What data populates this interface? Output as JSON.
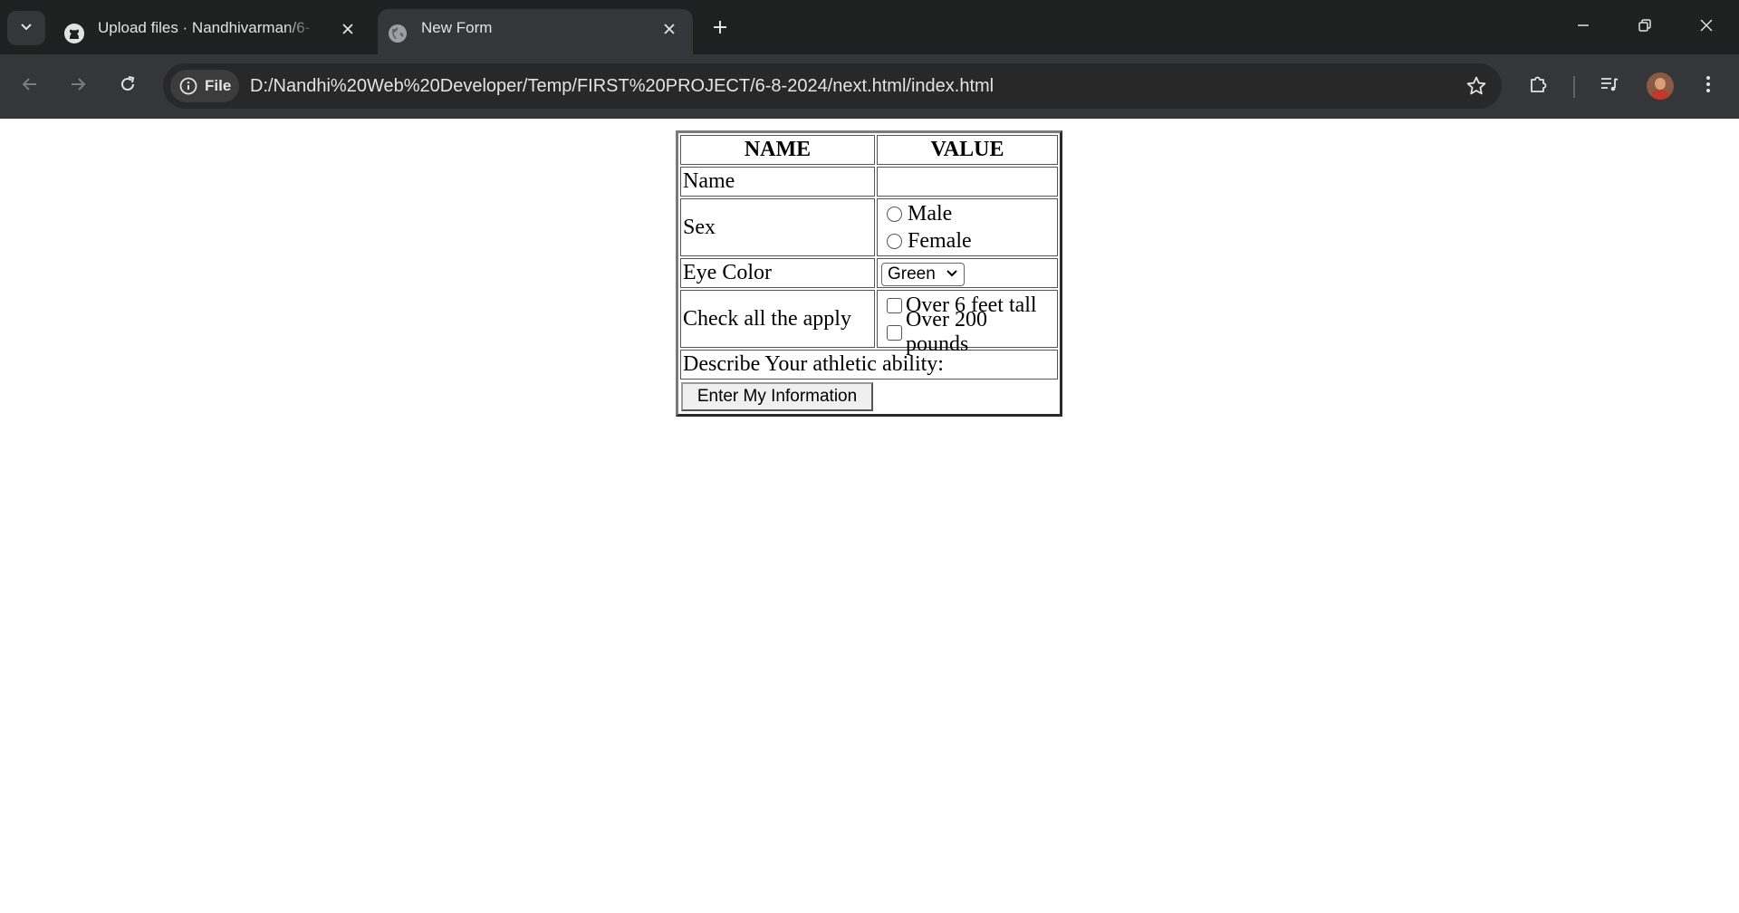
{
  "browser": {
    "tabs": [
      {
        "title": "Upload files · Nandhivarman/6-",
        "icon": "github-icon",
        "active": false
      },
      {
        "title": "New Form",
        "icon": "globe-icon",
        "active": true
      }
    ],
    "address_bar": {
      "chip_label": "File",
      "url": "D:/Nandhi%20Web%20Developer/Temp/FIRST%20PROJECT/6-8-2024/next.html/index.html"
    }
  },
  "form": {
    "headers": {
      "name": "NAME",
      "value": "VALUE"
    },
    "rows": {
      "name_label": "Name",
      "name_value": "",
      "sex_label": "Sex",
      "sex_options": [
        "Male",
        "Female"
      ],
      "eye_label": "Eye Color",
      "eye_selected": "Green",
      "check_label": "Check all the apply",
      "check_options": [
        "Over 6 feet tall",
        "Over 200 pounds"
      ],
      "describe_label": "Describe Your athletic ability:"
    },
    "submit_label": "Enter My Information"
  }
}
